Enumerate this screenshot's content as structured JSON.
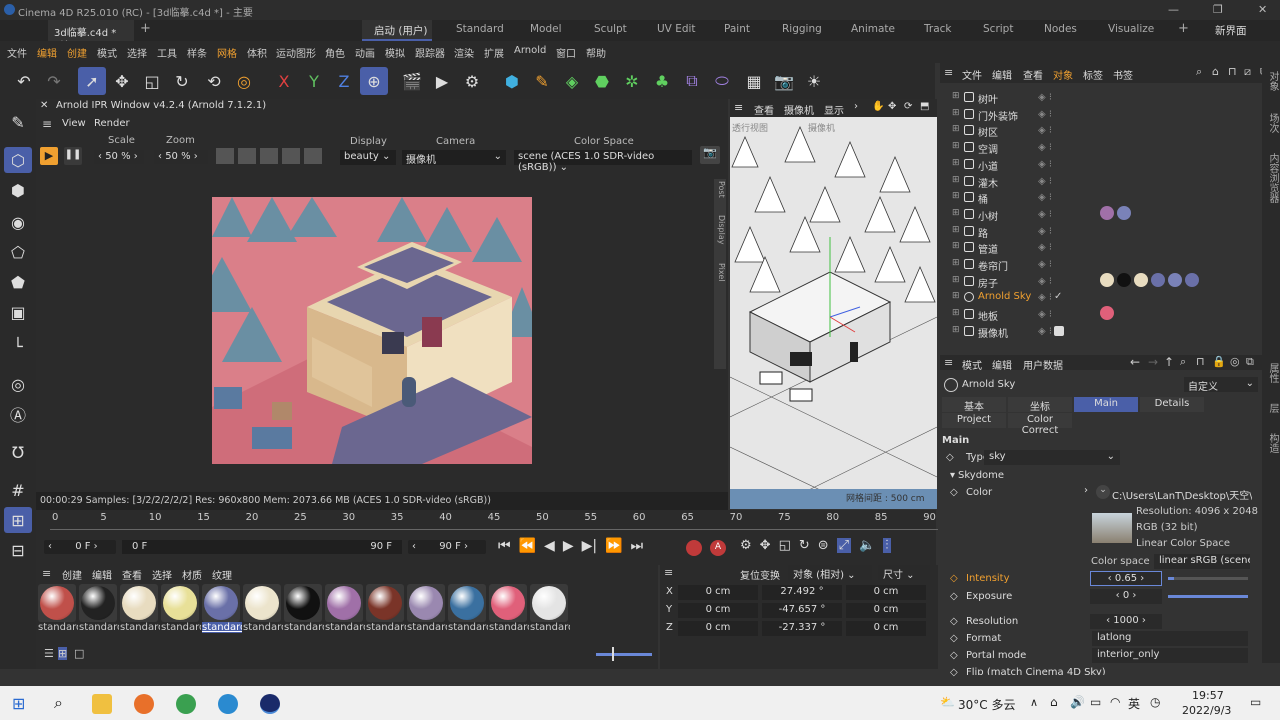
{
  "window": {
    "title": "Cinema 4D R25.010 (RC) - [3d临摹.c4d *] - 主要"
  },
  "tabs": {
    "doc": "3d临摹.c4d *",
    "plus": "+",
    "new_interface": "新界面"
  },
  "layouts": [
    "启动 (用户)",
    "Standard",
    "Model",
    "Sculpt",
    "UV Edit",
    "Paint",
    "Rigging",
    "Animate",
    "Track",
    "Script",
    "Nodes",
    "Visualize"
  ],
  "menu": [
    "文件",
    "编辑",
    "创建",
    "模式",
    "选择",
    "工具",
    "样条",
    "网格",
    "体积",
    "运动图形",
    "角色",
    "动画",
    "模拟",
    "跟踪器",
    "渲染",
    "扩展",
    "Arnold",
    "窗口",
    "帮助"
  ],
  "ipr": {
    "title": "Arnold IPR Window v4.2.4 (Arnold 7.1.2.1)",
    "menu_view": "View",
    "menu_render": "Render",
    "scale_label": "Scale",
    "scale_value": "50 %",
    "zoom_label": "Zoom",
    "zoom_value": "50 %",
    "display_label": "Display",
    "display_value": "beauty",
    "camera_label": "Camera",
    "camera_value": "摄像机",
    "colorspace_label": "Color Space",
    "colorspace_value": "scene (ACES 1.0 SDR-video (sRGB))",
    "status": "00:00:29  Samples: [3/2/2/2/2/2]  Res: 960x800  Mem: 2073.66 MB  (ACES 1.0 SDR-video (sRGB))",
    "side_tabs": [
      "Post",
      "Display",
      "Pixel"
    ]
  },
  "viewport": {
    "menu": [
      "查看",
      "摄像机",
      "显示"
    ],
    "label": "透行视图",
    "cam": "摄像机",
    "grid": "网格间距 : 500 cm"
  },
  "object_manager": {
    "menu": [
      "文件",
      "编辑",
      "查看",
      "对象",
      "标签",
      "书签"
    ],
    "objects": [
      {
        "name": "树叶",
        "type": "null"
      },
      {
        "name": "门外装饰",
        "type": "null"
      },
      {
        "name": "树区",
        "type": "null"
      },
      {
        "name": "空调",
        "type": "null"
      },
      {
        "name": "小道",
        "type": "null"
      },
      {
        "name": "灌木",
        "type": "null"
      },
      {
        "name": "桶",
        "type": "null"
      },
      {
        "name": "小树",
        "type": "poly"
      },
      {
        "name": "路",
        "type": "null"
      },
      {
        "name": "管道",
        "type": "null"
      },
      {
        "name": "卷帘门",
        "type": "null"
      },
      {
        "name": "房子",
        "type": "poly"
      },
      {
        "name": "Arnold Sky",
        "type": "sky"
      },
      {
        "name": "地板",
        "type": "null"
      },
      {
        "name": "摄像机",
        "type": "camera"
      }
    ]
  },
  "attributes": {
    "menu": [
      "模式",
      "编辑",
      "用户数据"
    ],
    "object_name": "Arnold Sky",
    "preset": "自定义",
    "tabs_row1": [
      "基本",
      "坐标",
      "Main",
      "Details"
    ],
    "tabs_row2": [
      "Project",
      "Color Correct"
    ],
    "section": "Main",
    "type_label": "Type",
    "type_value": "sky",
    "skydome": "Skydome",
    "color_label": "Color",
    "color_path": "C:\\Users\\LanT\\Desktop\\天空\\fo",
    "res_info": "Resolution: 4096 x 2048",
    "rgb_info": "RGB (32 bit)",
    "lin_info": "Linear Color Space",
    "colorspace_label": "Color space",
    "colorspace_value": "linear sRGB (scene-l",
    "intensity_label": "Intensity",
    "intensity_value": "0.65",
    "exposure_label": "Exposure",
    "exposure_value": "0",
    "resolution_label": "Resolution",
    "resolution_value": "1000",
    "format_label": "Format",
    "format_value": "latlong",
    "portal_label": "Portal mode",
    "portal_value": "interior_only",
    "flip_label": "Flip (match Cinema 4D Sky)"
  },
  "timeline": {
    "ticks": [
      "0",
      "5",
      "10",
      "15",
      "20",
      "25",
      "30",
      "35",
      "40",
      "45",
      "50",
      "55",
      "60",
      "65",
      "70",
      "75",
      "80",
      "85",
      "90"
    ],
    "start": "0 F",
    "current": "0 F",
    "end1": "90 F",
    "end2": "90 F"
  },
  "materials": {
    "menu": [
      "创建",
      "编辑",
      "查看",
      "选择",
      "材质",
      "纹理"
    ],
    "label": "standard",
    "colors": [
      "#c0504a",
      "#222222",
      "#e8dcc0",
      "#e8e098",
      "#6a70a8",
      "#ece4cc",
      "#111111",
      "#a070a8",
      "#7a3428",
      "#9a88b0",
      "#3a70a0",
      "#e0607a",
      "#e4e4e4"
    ]
  },
  "coordinates": {
    "header": [
      "复位变换",
      "对象 (相对)",
      "尺寸"
    ],
    "rows": [
      {
        "axis": "X",
        "pos": "0 cm",
        "rot": "27.492 °",
        "size": "0 cm"
      },
      {
        "axis": "Y",
        "pos": "0 cm",
        "rot": "-47.657 °",
        "size": "0 cm"
      },
      {
        "axis": "Z",
        "pos": "0 cm",
        "rot": "-27.337 °",
        "size": "0 cm"
      }
    ]
  },
  "taskbar": {
    "weather": "30°C 多云",
    "ime": "英",
    "time": "19:57",
    "date": "2022/9/3"
  },
  "right_strip": [
    "对象",
    "场次",
    "内容浏览器",
    "属性",
    "层",
    "构造"
  ]
}
